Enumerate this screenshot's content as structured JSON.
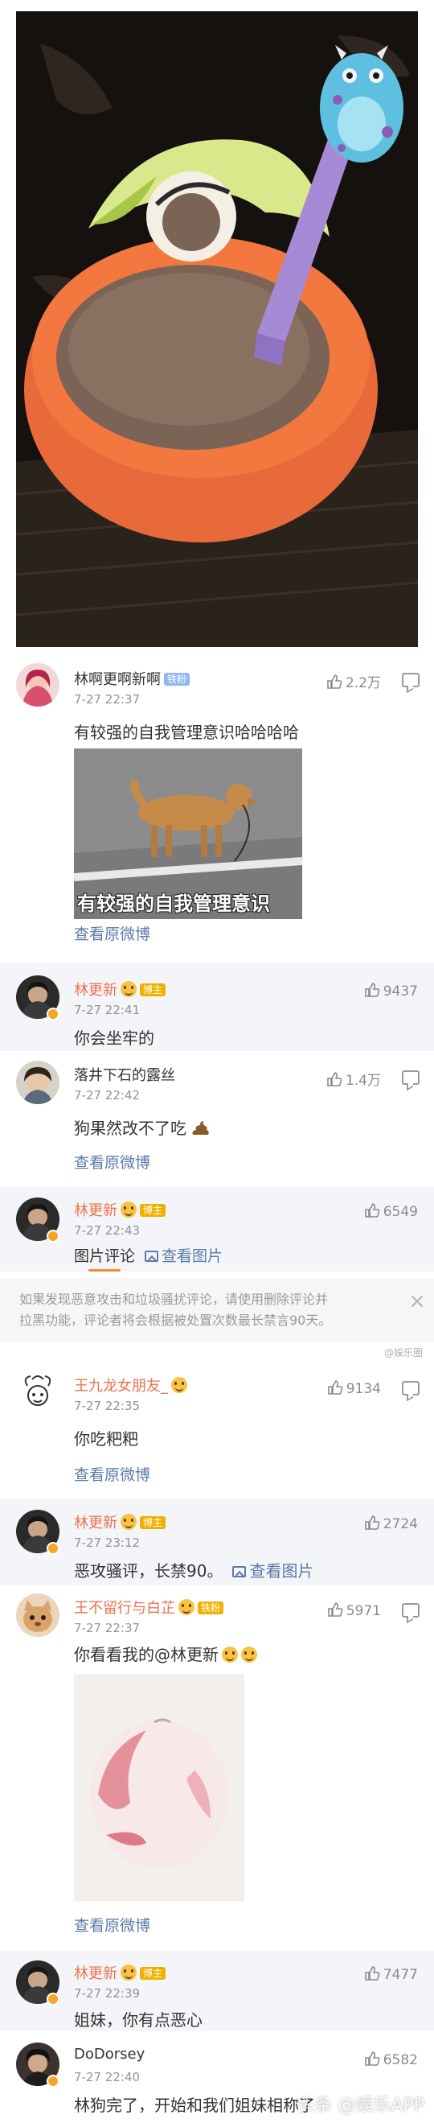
{
  "colors": {
    "accent_orange": "#eb7350",
    "link_blue": "#5b7ba8",
    "meta_gray": "#939393",
    "tab_underline": "#f58a2c"
  },
  "comments": [
    {
      "name": "林啊更啊新啊",
      "tag": "铁粉",
      "time": "7-27 22:37",
      "text": "有较强的自我管理意识哈哈哈哈",
      "likes": "2.2万",
      "caption": "有较强的自我管理意识",
      "link": "查看原微博"
    },
    {
      "name": "林更新",
      "tag": "博主",
      "time": "7-27 22:41",
      "text": "你会坐牢的",
      "likes": "9437"
    },
    {
      "name": "落井下石的露丝",
      "time": "7-27 22:42",
      "text": "狗果然改不了吃",
      "likes": "1.4万",
      "link": "查看原微博"
    },
    {
      "name": "林更新",
      "tag": "博主",
      "time": "7-27 22:43",
      "likes": "6549",
      "tab_active": "图片评论",
      "view_image": "查看图片"
    },
    {
      "name": "王九龙女朋友_",
      "time": "7-27 22:35",
      "text": "你吃粑粑",
      "likes": "9134",
      "link": "查看原微博"
    },
    {
      "name": "林更新",
      "tag": "博主",
      "time": "7-27 23:12",
      "text": "恶攻骚评，长禁90。",
      "likes": "2724",
      "view_image": "查看图片"
    },
    {
      "name": "王不留行与白芷",
      "tag": "铁粉",
      "time": "7-27 22:37",
      "text": "你看看我的@林更新",
      "likes": "5971",
      "link": "查看原微博"
    },
    {
      "name": "林更新",
      "tag": "博主",
      "time": "7-27 22:39",
      "text": "姐妹，你有点恶心",
      "likes": "7477"
    },
    {
      "name": "DoDorsey",
      "time": "7-27 22:40",
      "text": "林狗完了，开始和我们姐妹相称了",
      "likes": "6582"
    }
  ],
  "notice": {
    "line1": "如果发现恶意攻击和垃圾骚扰评论，请使用删除评论并",
    "line2": "拉黑功能，评论者将会根据被处置次数最长禁言90天。"
  },
  "watermarks": {
    "bottom": "头条 @娱乐APP",
    "small": "@娱乐圈"
  },
  "icons": [
    "thumb-up-icon",
    "reply-icon",
    "image-icon",
    "close-icon",
    "emoji-icon",
    "v-badge-icon"
  ]
}
